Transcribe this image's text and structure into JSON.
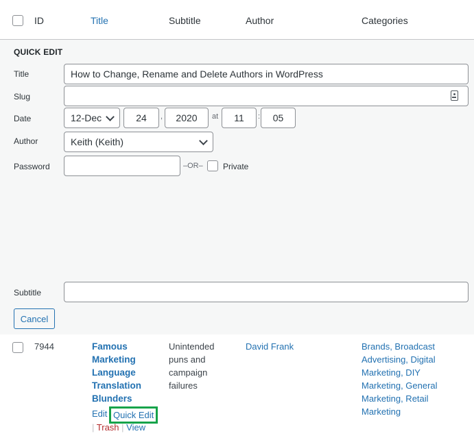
{
  "header": {
    "columns": {
      "id": "ID",
      "title": "Title",
      "subtitle": "Subtitle",
      "author": "Author",
      "categories": "Categories"
    }
  },
  "quick_edit": {
    "heading": "QUICK EDIT",
    "title_label": "Title",
    "title_value": "How to Change, Rename and Delete Authors in WordPress",
    "slug_label": "Slug",
    "slug_value": "",
    "date_label": "Date",
    "month": "12-Dec",
    "day": "24",
    "comma": ",",
    "year": "2020",
    "at": "at",
    "hour": "11",
    "colon": ":",
    "minute": "05",
    "author_label": "Author",
    "author_value": "Keith (Keith)",
    "password_label": "Password",
    "password_value": "",
    "or_text": "–OR–",
    "private_label": "Private",
    "subtitle_label": "Subtitle",
    "subtitle_value": "",
    "cancel_label": "Cancel"
  },
  "row": {
    "id": "7944",
    "title_lines": [
      "Famous",
      "Marketing",
      "Language",
      "Translation",
      "Blunders"
    ],
    "subtitle_lines": [
      "Unintended",
      "puns and",
      "campaign",
      "failures"
    ],
    "author": "David Frank",
    "categories_lines": [
      "Brands, Broadcast",
      "Advertising, Digital",
      "Marketing, DIY",
      "Marketing, General",
      "Marketing, Retail",
      "Marketing"
    ],
    "actions": {
      "edit": "Edit",
      "quick_edit": "Quick Edit",
      "trash": "Trash",
      "view": "View",
      "separator": "|"
    }
  },
  "colors": {
    "link": "#2271b1",
    "highlight": "#16a34a",
    "trash": "#b32d2e"
  }
}
